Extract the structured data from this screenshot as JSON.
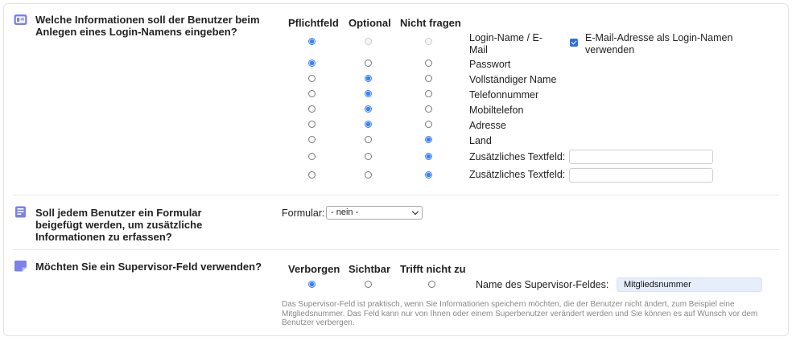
{
  "section1": {
    "question": "Welche Informationen soll der Benutzer beim Anlegen eines Login-Namens eingeben?",
    "columns": [
      "Pflichtfeld",
      "Optional",
      "Nicht fragen"
    ],
    "rows": [
      {
        "label": "Login-Name / E-Mail",
        "selected": 0,
        "disabled_others": true
      },
      {
        "label": "Passwort",
        "selected": 0
      },
      {
        "label": "Vollständiger Name",
        "selected": 1
      },
      {
        "label": "Telefonnummer",
        "selected": 1
      },
      {
        "label": "Mobiltelefon",
        "selected": 1
      },
      {
        "label": "Adresse",
        "selected": 1
      },
      {
        "label": "Land",
        "selected": 2
      },
      {
        "label": "Zusätzliches Textfeld:",
        "selected": 2,
        "has_text_input": true
      },
      {
        "label": "Zusätzliches Textfeld:",
        "selected": 2,
        "has_text_input": true
      }
    ],
    "email_checkbox_label": "E-Mail-Adresse als Login-Namen verwenden",
    "email_checkbox_checked": true
  },
  "section2": {
    "question": "Soll jedem Benutzer ein Formular beigefügt werden, um zusätzliche Informationen zu erfassen?",
    "form_label": "Formular:",
    "form_selected": "- nein -"
  },
  "section3": {
    "question": "Möchten Sie ein Supervisor-Feld verwenden?",
    "columns": [
      "Verborgen",
      "Sichtbar",
      "Trifft nicht zu"
    ],
    "selected": 0,
    "field_label": "Name des Supervisor-Feldes:",
    "field_value": "Mitgliedsnummer",
    "help": "Das Supervisor-Feld ist praktisch, wenn Sie Informationen speichern möchten, die der Benutzer nicht ändert, zum Beispiel eine Mitgliedsnummer. Das Feld kann nur von Ihnen oder einem Superbenutzer verändert werden und Sie können es auf Wunsch vor dem Benutzer verbergen."
  },
  "colors": {
    "accent": "#3b82f6",
    "icon": "#7b82e8"
  },
  "icons": {
    "section1": "id-card-icon",
    "section2": "form-icon",
    "section3": "note-icon"
  }
}
